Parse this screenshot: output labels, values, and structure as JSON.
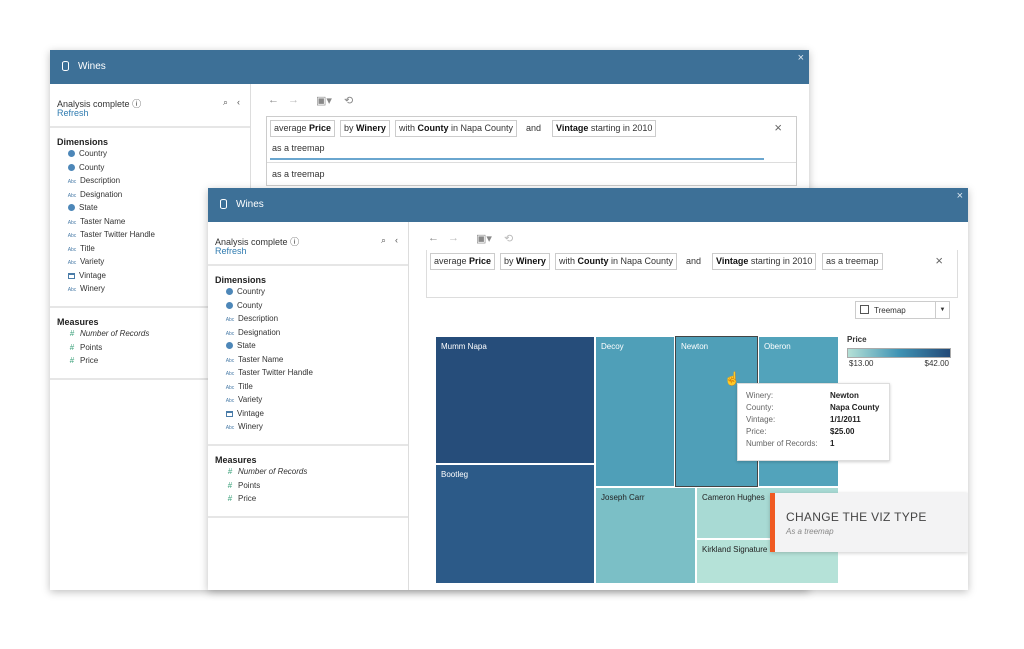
{
  "window_title": "Wines",
  "close_icon": "×",
  "sidebar": {
    "status": "Analysis complete",
    "refresh": "Refresh",
    "dimensions_label": "Dimensions",
    "dimensions": [
      {
        "label": "Country",
        "icon": "globe-icon"
      },
      {
        "label": "County",
        "icon": "globe-icon"
      },
      {
        "label": "Description",
        "icon": "abc-icon"
      },
      {
        "label": "Designation",
        "icon": "abc-icon"
      },
      {
        "label": "State",
        "icon": "globe-icon"
      },
      {
        "label": "Taster Name",
        "icon": "abc-icon"
      },
      {
        "label": "Taster Twitter Handle",
        "icon": "abc-icon"
      },
      {
        "label": "Title",
        "icon": "abc-icon"
      },
      {
        "label": "Variety",
        "icon": "abc-icon"
      },
      {
        "label": "Vintage",
        "icon": "calendar-icon"
      },
      {
        "label": "Winery",
        "icon": "abc-icon"
      }
    ],
    "measures_label": "Measures",
    "measures": [
      {
        "label": "Number of Records",
        "icon": "hash-icon"
      },
      {
        "label": "Points",
        "icon": "hash-icon"
      },
      {
        "label": "Price",
        "icon": "hash-icon"
      }
    ],
    "abc": "Abc"
  },
  "query": {
    "pills": [
      {
        "pre": "average ",
        "bold": "Price",
        "post": ""
      },
      {
        "pre": "by ",
        "bold": "Winery",
        "post": ""
      },
      {
        "pre": "with ",
        "bold": "County",
        "post": " in Napa County"
      },
      {
        "pre": "",
        "bold": "Vintage",
        "post": " starting in 2010"
      }
    ],
    "and": "and",
    "typing": "as a treemap",
    "suggestion": "as a treemap",
    "final_pill": "as a treemap"
  },
  "viz_type": "Treemap",
  "legend": {
    "title": "Price",
    "min": "$13.00",
    "max": "$42.00",
    "color_low": "#b5e0d6",
    "color_high": "#234a78"
  },
  "chart_data": {
    "type": "treemap",
    "categories": [
      "Mumm Napa",
      "Bootleg",
      "Decoy",
      "Newton",
      "Oberon",
      "Joseph Carr",
      "Cameron Hughes",
      "Kirkland Signature"
    ],
    "colors": [
      "#264d7a",
      "#2c5a88",
      "#4f9fb8",
      "#4f9fb8",
      "#52a3bb",
      "#7bbfc6",
      "#a8dad4",
      "#b5e2d8"
    ],
    "color_by": "Price",
    "highlighted": "Newton"
  },
  "tooltip": [
    {
      "k": "Winery:",
      "v": "Newton"
    },
    {
      "k": "County:",
      "v": "Napa County"
    },
    {
      "k": "Vintage:",
      "v": "1/1/2011"
    },
    {
      "k": "Price:",
      "v": "$25.00"
    },
    {
      "k": "Number of Records:",
      "v": "1"
    }
  ],
  "callout": {
    "title": "CHANGE THE VIZ TYPE",
    "subtitle": "As a treemap",
    "accent": "#f05a22"
  }
}
